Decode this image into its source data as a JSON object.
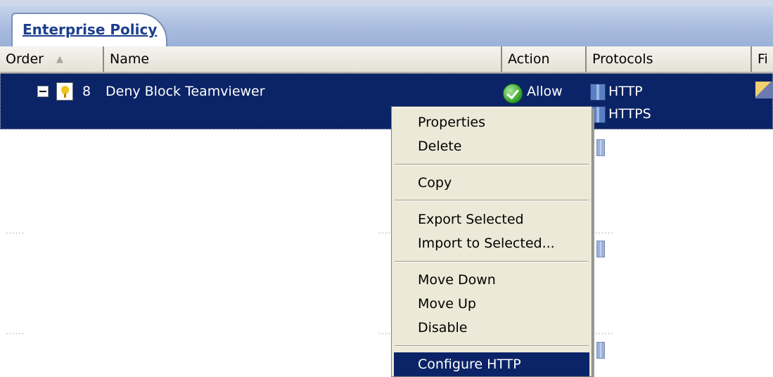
{
  "tab": {
    "label": "Enterprise Policy"
  },
  "columns": {
    "order": "Order",
    "name": "Name",
    "action": "Action",
    "protocols": "Protocols",
    "next": "Fi"
  },
  "selected_rule": {
    "order": "8",
    "name": "Deny Block Teamviewer",
    "action": "Allow",
    "protocols": [
      "HTTP",
      "HTTPS"
    ]
  },
  "placeholder_dots": "......",
  "context_menu": {
    "items": [
      {
        "label": "Properties"
      },
      {
        "label": "Delete"
      },
      {
        "label": "Copy"
      },
      {
        "label": "Export Selected"
      },
      {
        "label": "Import to Selected..."
      },
      {
        "label": "Move Down"
      },
      {
        "label": "Move Up"
      },
      {
        "label": "Disable"
      },
      {
        "label": "Configure HTTP"
      }
    ],
    "highlighted_item": "Configure HTTP"
  },
  "icons": {
    "expander": "collapse-minus-icon",
    "rule": "rule-bulb-icon",
    "action": "allow-check-icon",
    "protocol": "protocol-server-icon",
    "sort": "sort-ascending-icon"
  },
  "colors": {
    "selection": "#0b2467",
    "menu_background": "#ece9d8",
    "tab_text": "#1d3f8e",
    "allow_green": "#2f9e24"
  }
}
